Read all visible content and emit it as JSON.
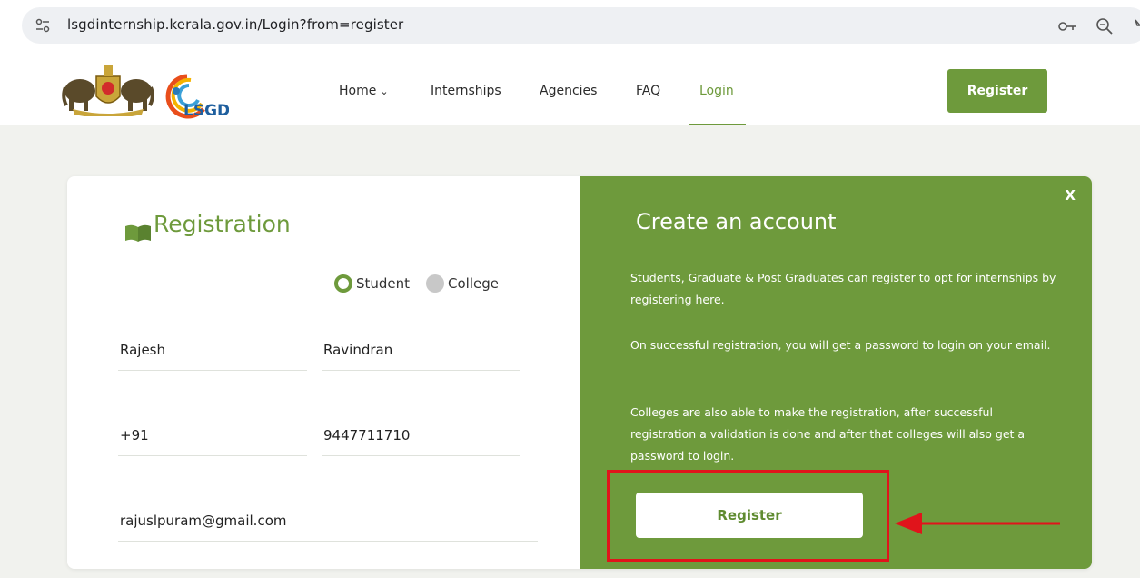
{
  "browser": {
    "url": "lsgdinternship.kerala.gov.in/Login?from=register"
  },
  "header": {
    "logo_text": "LSGD",
    "nav": {
      "home": "Home",
      "internships": "Internships",
      "agencies": "Agencies",
      "faq": "FAQ",
      "login": "Login"
    },
    "register_label": "Register"
  },
  "registration": {
    "title": "Registration",
    "user_type": {
      "student": "Student",
      "college": "College",
      "selected": "Student"
    },
    "fields": {
      "first_name": "Rajesh",
      "last_name": "Ravindran",
      "country_code": "+91",
      "phone": "9447711710",
      "email": "rajuslpuram@gmail.com"
    }
  },
  "account_panel": {
    "close_label": "X",
    "title": "Create an account",
    "paragraphs": [
      "Students, Graduate & Post Graduates can register to opt for internships by registering here.",
      "On successful registration, you will get a password to login on your email.",
      "Colleges are also able to make the registration, after successful registration a validation is done and after that colleges will also get a password to login."
    ],
    "register_label": "Register"
  },
  "colors": {
    "brand_green": "#6e9a3c",
    "annotation_red": "#e0141b"
  }
}
